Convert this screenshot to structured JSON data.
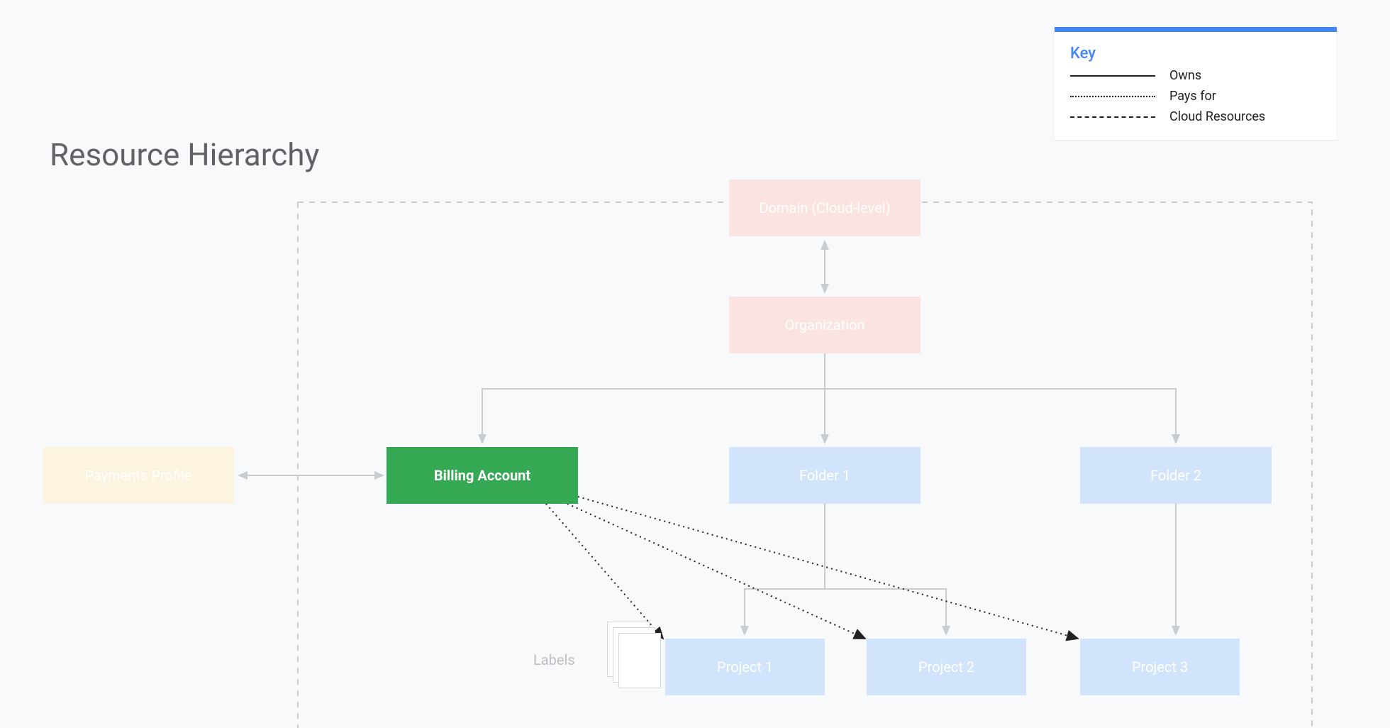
{
  "title": "Resource Hierarchy",
  "legend": {
    "title": "Key",
    "items": [
      {
        "style": "solid",
        "label": "Owns"
      },
      {
        "style": "dotted",
        "label": "Pays for"
      },
      {
        "style": "dashed",
        "label": "Cloud Resources"
      }
    ]
  },
  "nodes": {
    "domain": "Domain (Cloud-level)",
    "organization": "Organization",
    "payments_profile": "Payments Profile",
    "billing_account": "Billing Account",
    "folder1": "Folder 1",
    "folder2": "Folder 2",
    "project1": "Project 1",
    "project2": "Project 2",
    "project3": "Project 3",
    "labels": "Labels"
  },
  "edges": {
    "owns": [
      [
        "domain",
        "organization",
        "bidirectional"
      ],
      [
        "payments_profile",
        "billing_account",
        "bidirectional"
      ],
      [
        "organization",
        "billing_account",
        "down"
      ],
      [
        "organization",
        "folder1",
        "down"
      ],
      [
        "organization",
        "folder2",
        "down"
      ],
      [
        "folder1",
        "project1",
        "down"
      ],
      [
        "folder1",
        "project2",
        "down"
      ],
      [
        "folder2",
        "project3",
        "down"
      ]
    ],
    "pays_for": [
      [
        "billing_account",
        "project1"
      ],
      [
        "billing_account",
        "project2"
      ],
      [
        "billing_account",
        "project3"
      ]
    ],
    "cloud_resources_boundary": true
  },
  "colors": {
    "highlight": "#34a853",
    "faded_red": "#fbe3e1",
    "faded_blue": "#d2e3fc",
    "faded_yellow": "#fdf4e0",
    "accent_blue": "#4285f4",
    "text_gray": "#5f6368",
    "line_gray": "#c7ccd1"
  }
}
